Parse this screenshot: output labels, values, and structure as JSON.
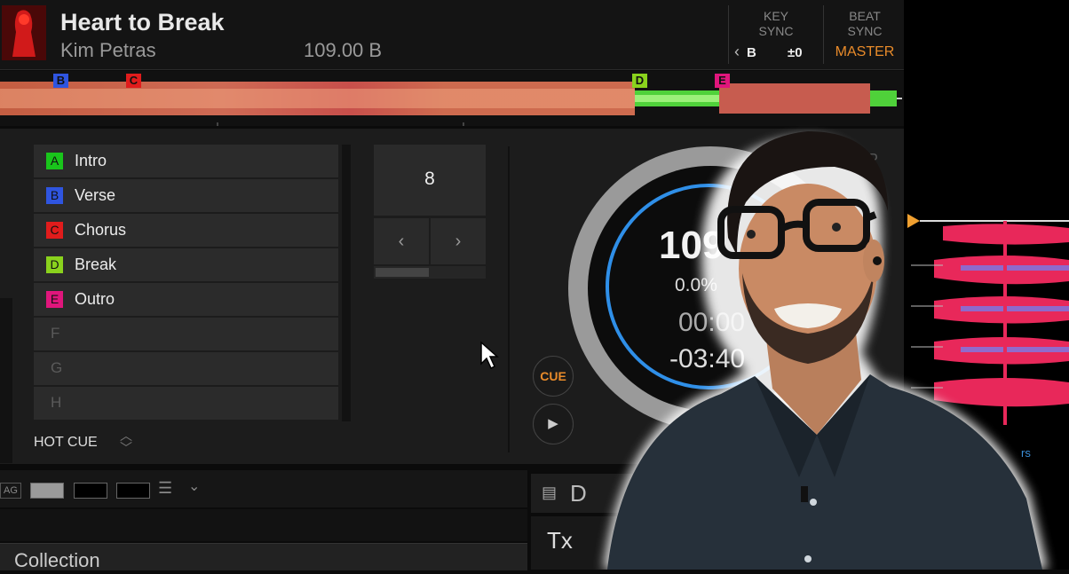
{
  "deck": {
    "title": "Heart to Break",
    "artist": "Kim Petras",
    "bpm_key": "109.00 B",
    "key_sync_label": "KEY\nSYNC",
    "key_value": "B",
    "key_offset": "±0",
    "beat_sync_label": "BEAT\nSYNC",
    "master_label": "MASTER",
    "key_left_arrow": "‹"
  },
  "waveform_markers": [
    {
      "label": "B",
      "color": "#2f55e0"
    },
    {
      "label": "C",
      "color": "#e01c1c"
    },
    {
      "label": "D",
      "color": "#8ad21d"
    },
    {
      "label": "E",
      "color": "#e0167c"
    }
  ],
  "hot_cues": [
    {
      "letter": "A",
      "label": "Intro",
      "color": "#19c51b"
    },
    {
      "letter": "B",
      "label": "Verse",
      "color": "#2f55e0"
    },
    {
      "letter": "C",
      "label": "Chorus",
      "color": "#e01c1c"
    },
    {
      "letter": "D",
      "label": "Break",
      "color": "#8ad21d"
    },
    {
      "letter": "E",
      "label": "Outro",
      "color": "#e0167c"
    },
    {
      "letter": "F",
      "label": ""
    },
    {
      "letter": "G",
      "label": ""
    },
    {
      "letter": "H",
      "label": ""
    }
  ],
  "hotcue_footer": "HOT CUE",
  "loop": {
    "value": "8",
    "prev": "‹",
    "next": "›"
  },
  "transport": {
    "cue_label": "CUE",
    "play_symbol": "▶"
  },
  "jog": {
    "bpm": "109",
    "pitch": "0.0%",
    "elapsed": "00:00",
    "remaining": "-03:40",
    "mode_label": "JP"
  },
  "right_label": "rs",
  "browser": {
    "tag_label": "AG",
    "collection_label": "Collection",
    "panel_label": "D",
    "txt_label": "Tx"
  },
  "colors": {
    "accent_orange": "#e98b2a",
    "jog_blue": "#2f8fe8"
  }
}
